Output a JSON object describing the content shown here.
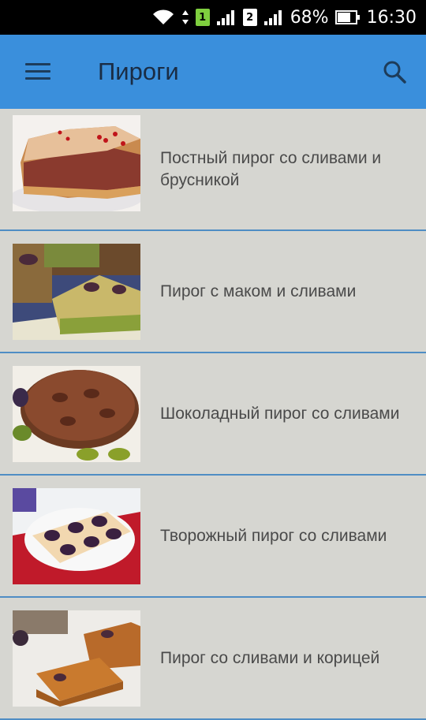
{
  "status_bar": {
    "battery": "68%",
    "time": "16:30",
    "sim1": "1",
    "sim2": "2",
    "icons": [
      "wifi-icon",
      "sim1-icon",
      "signal-icon",
      "sim2-icon",
      "signal-icon",
      "battery-icon"
    ]
  },
  "app_bar": {
    "title": "Пироги",
    "menu_icon": "hamburger-menu-icon",
    "search_icon": "search-icon",
    "color": "#3a8fdc"
  },
  "recipes": [
    {
      "title": "Постный пирог со сливами и брусникой",
      "image": "cake-with-berries-thumbnail"
    },
    {
      "title": "Пирог с маком и сливами",
      "image": "poppy-seed-plum-cake-thumbnail"
    },
    {
      "title": "Шоколадный пирог со сливами",
      "image": "chocolate-plum-cake-thumbnail"
    },
    {
      "title": "Творожный пирог со сливами",
      "image": "cottage-cheese-plum-cake-thumbnail"
    },
    {
      "title": "Пирог со сливами и корицей",
      "image": "plum-cinnamon-cake-thumbnail"
    }
  ]
}
